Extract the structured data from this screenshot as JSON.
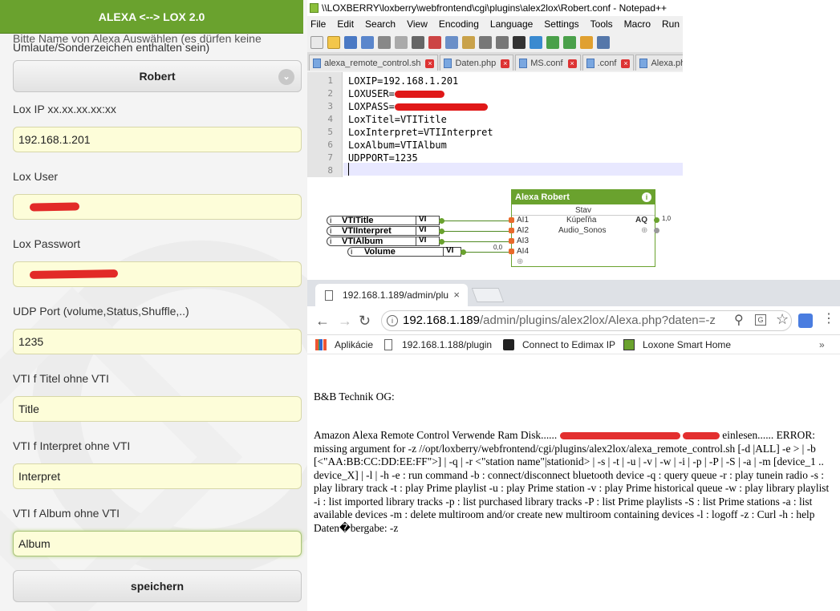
{
  "form": {
    "header": "ALEXA <--> LOX 2.0",
    "intro_line1": "Bitte Name von Alexa Auswählen (es dürfen keine",
    "intro_line2": "Umlaute/Sonderzeichen enthalten sein)",
    "name_select": "Robert",
    "lox_ip_label": "Lox IP xx.xx.xx.xx:xx",
    "lox_ip_value": "192.168.1.201",
    "lox_user_label": "Lox User",
    "lox_pass_label": "Lox Passwort",
    "udp_label": "UDP Port (volume,Status,Shuffle,..)",
    "udp_value": "1235",
    "title_label": "VTI f Titel ohne VTI",
    "title_value": "Title",
    "interpret_label": "VTI f Interpret ohne VTI",
    "interpret_value": "Interpret",
    "album_label": "VTI f Album ohne VTI",
    "album_value": "Album",
    "save_button": "speichern"
  },
  "notepad": {
    "title": "\\\\LOXBERRY\\loxberry\\webfrontend\\cgi\\plugins\\alex2lox\\Robert.conf - Notepad++",
    "menu": [
      "File",
      "Edit",
      "Search",
      "View",
      "Encoding",
      "Language",
      "Settings",
      "Tools",
      "Macro",
      "Run"
    ],
    "tabs": [
      "alexa_remote_control.sh",
      "Daten.php",
      "MS.conf",
      ".conf",
      "Alexa.php"
    ],
    "line_numbers": [
      "1",
      "2",
      "3",
      "4",
      "5",
      "6",
      "7",
      "8"
    ],
    "lines": [
      "LOXIP=192.168.1.201",
      "LOXUSER=",
      "LOXPASS=",
      "LoxTitel=VTITitle",
      "LoxInterpret=VTIInterpret",
      "LoxAlbum=VTIAlbum",
      "UDPPORT=1235",
      ""
    ]
  },
  "loxone": {
    "block_title": "Alexa Robert",
    "inputs": [
      {
        "name": "VTITitle",
        "tag": "VI"
      },
      {
        "name": "VTIInterpret",
        "tag": "VI"
      },
      {
        "name": "VTIAlbum",
        "tag": "VI"
      },
      {
        "name": "Volume",
        "tag": "VI"
      }
    ],
    "volume_value": "0,0",
    "block_state_label": "Stav",
    "ports": [
      "AI1",
      "AI2",
      "AI3",
      "AI4"
    ],
    "room": "Kúpeľňa",
    "zone": "Audio_Sonos",
    "output_label": "AQ",
    "output_value": "1,0"
  },
  "chrome": {
    "tab_title": "192.168.1.189/admin/plu",
    "url_host": "192.168.1.189",
    "url_path": "/admin/plugins/alex2lox/Alexa.php?daten=-z",
    "bookmarks": [
      "Aplikácie",
      "192.168.1.188/plugin",
      "Connect to Edimax IP",
      "Loxone Smart Home"
    ],
    "company": "B&B Technik OG:",
    "msg_start": "Amazon Alexa Remote Control Verwende Ram Disk......",
    "msg_after_redact": "einlesen......",
    "msg_body": "ERROR: missing argument for -z //opt/loxberry/webfrontend/cgi/plugins/alex2lox/alexa_remote_control.sh [-d |ALL] -e > | -b [<\"AA:BB:CC:DD:EE:FF\">] | -q | -r <\"station name\"|stationid> | -s | -t | -u | -v | -w | -i | -p | -P | -S | -a | -m [device_1 .. device_X] | -l | -h -e : run command -b : connect/disconnect bluetooth device -q : query queue -r : play tunein radio -s : play library track -t : play Prime playlist -u : play Prime station -v : play Prime historical queue -w : play library playlist -i : list imported library tracks -p : list purchased library tracks -P : list Prime playlists -S : list Prime stations -a : list available devices -m : delete multiroom and/or create new multiroom containing devices -l : logoff -z : Curl -h : help Daten�bergabe: -z"
  },
  "colors": {
    "loxberry_green": "#6aa22e",
    "field_yellow": "#fdfdd9",
    "redaction_red": "#e01818"
  }
}
